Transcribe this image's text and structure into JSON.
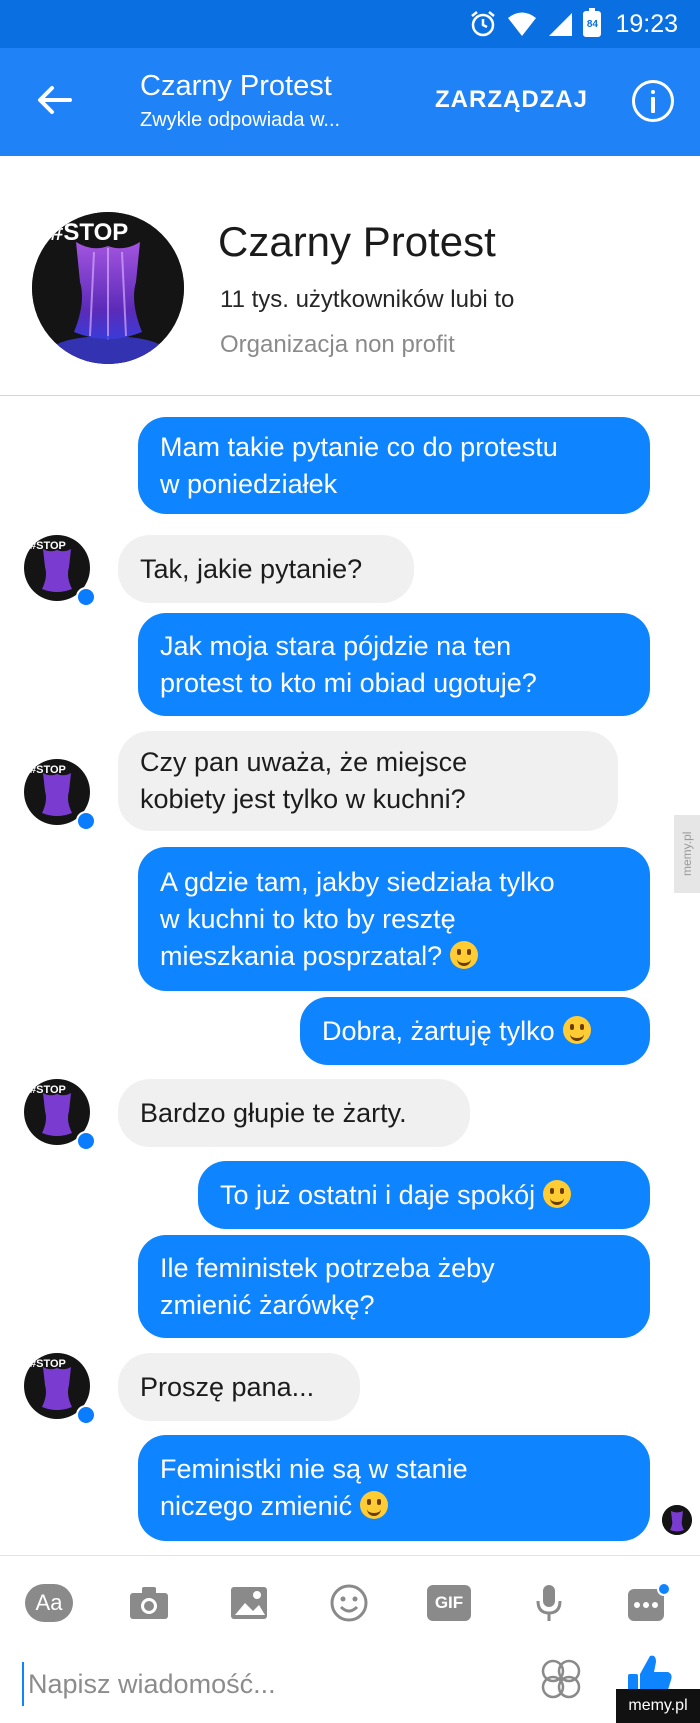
{
  "status_bar": {
    "time": "19:23",
    "battery": "84"
  },
  "header": {
    "title": "Czarny Protest",
    "subtitle": "Zwykle odpowiada w...",
    "manage_label": "ZARZĄDZAJ"
  },
  "profile": {
    "avatar_text": "#STOP",
    "name": "Czarny Protest",
    "likes": "11 tys. użytkowników lubi to",
    "category": "Organizacja non profit"
  },
  "messages": [
    {
      "dir": "out",
      "lines": [
        "Mam takie pytanie co do protestu",
        "w poniedziałek"
      ]
    },
    {
      "dir": "in",
      "lines": [
        "Tak, jakie pytanie?"
      ]
    },
    {
      "dir": "out",
      "lines": [
        "Jak moja stara pójdzie na ten",
        "protest to kto mi obiad ugotuje?"
      ]
    },
    {
      "dir": "in",
      "lines": [
        "Czy pan uważa, że miejsce",
        "kobiety jest tylko w kuchni?"
      ]
    },
    {
      "dir": "out",
      "lines": [
        "A gdzie tam, jakby siedziała tylko",
        "w kuchni to kto by resztę",
        "mieszkania posprzatal?"
      ],
      "emoji": "grinning-face"
    },
    {
      "dir": "out",
      "lines": [
        "Dobra, żartuję tylko"
      ],
      "emoji": "winking-face"
    },
    {
      "dir": "in",
      "lines": [
        "Bardzo głupie te żarty."
      ]
    },
    {
      "dir": "out",
      "lines": [
        "To już ostatni i daje spokój"
      ],
      "emoji": "slightly-smiling-face"
    },
    {
      "dir": "out",
      "lines": [
        "Ile feministek potrzeba żeby",
        "zmienić żarówkę?"
      ]
    },
    {
      "dir": "in",
      "lines": [
        "Proszę pana..."
      ]
    },
    {
      "dir": "out",
      "lines": [
        "Feministki nie są w stanie",
        "niczego zmienić"
      ],
      "emoji": "smiling-face-with-open-mouth"
    }
  ],
  "composer": {
    "aa_label": "Aa",
    "gif_label": "GIF",
    "placeholder": "Napisz wiadomość..."
  },
  "watermark": {
    "corner": "memy.pl",
    "side": "memy.pl"
  },
  "colors": {
    "status_bar": "#0a6fe0",
    "header": "#1f82f6",
    "outgoing": "#0f84ff",
    "incoming": "#f0f0f0"
  }
}
